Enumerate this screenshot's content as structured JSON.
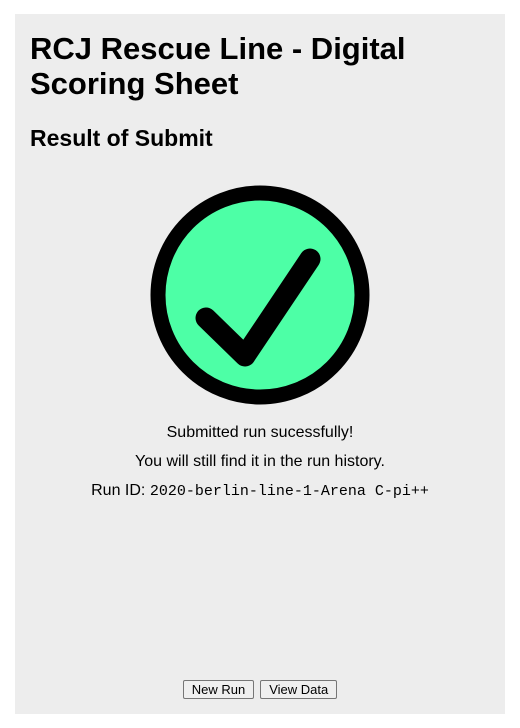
{
  "header": {
    "title": "RCJ Rescue Line - Digital Scoring Sheet",
    "subtitle": "Result of Submit"
  },
  "status": {
    "icon": "check-circle-icon",
    "icon_fill": "#4dffa6",
    "icon_stroke": "#000000",
    "message": "Submitted run sucessfully!",
    "note": "You will still find it in the run history.",
    "run_id_label": "Run ID:",
    "run_id_value": "2020-berlin-line-1-Arena C-pi++"
  },
  "actions": {
    "new_run_label": "New Run",
    "view_data_label": "View Data"
  },
  "colors": {
    "panel_background": "#ededed",
    "page_background": "#ffffff"
  }
}
